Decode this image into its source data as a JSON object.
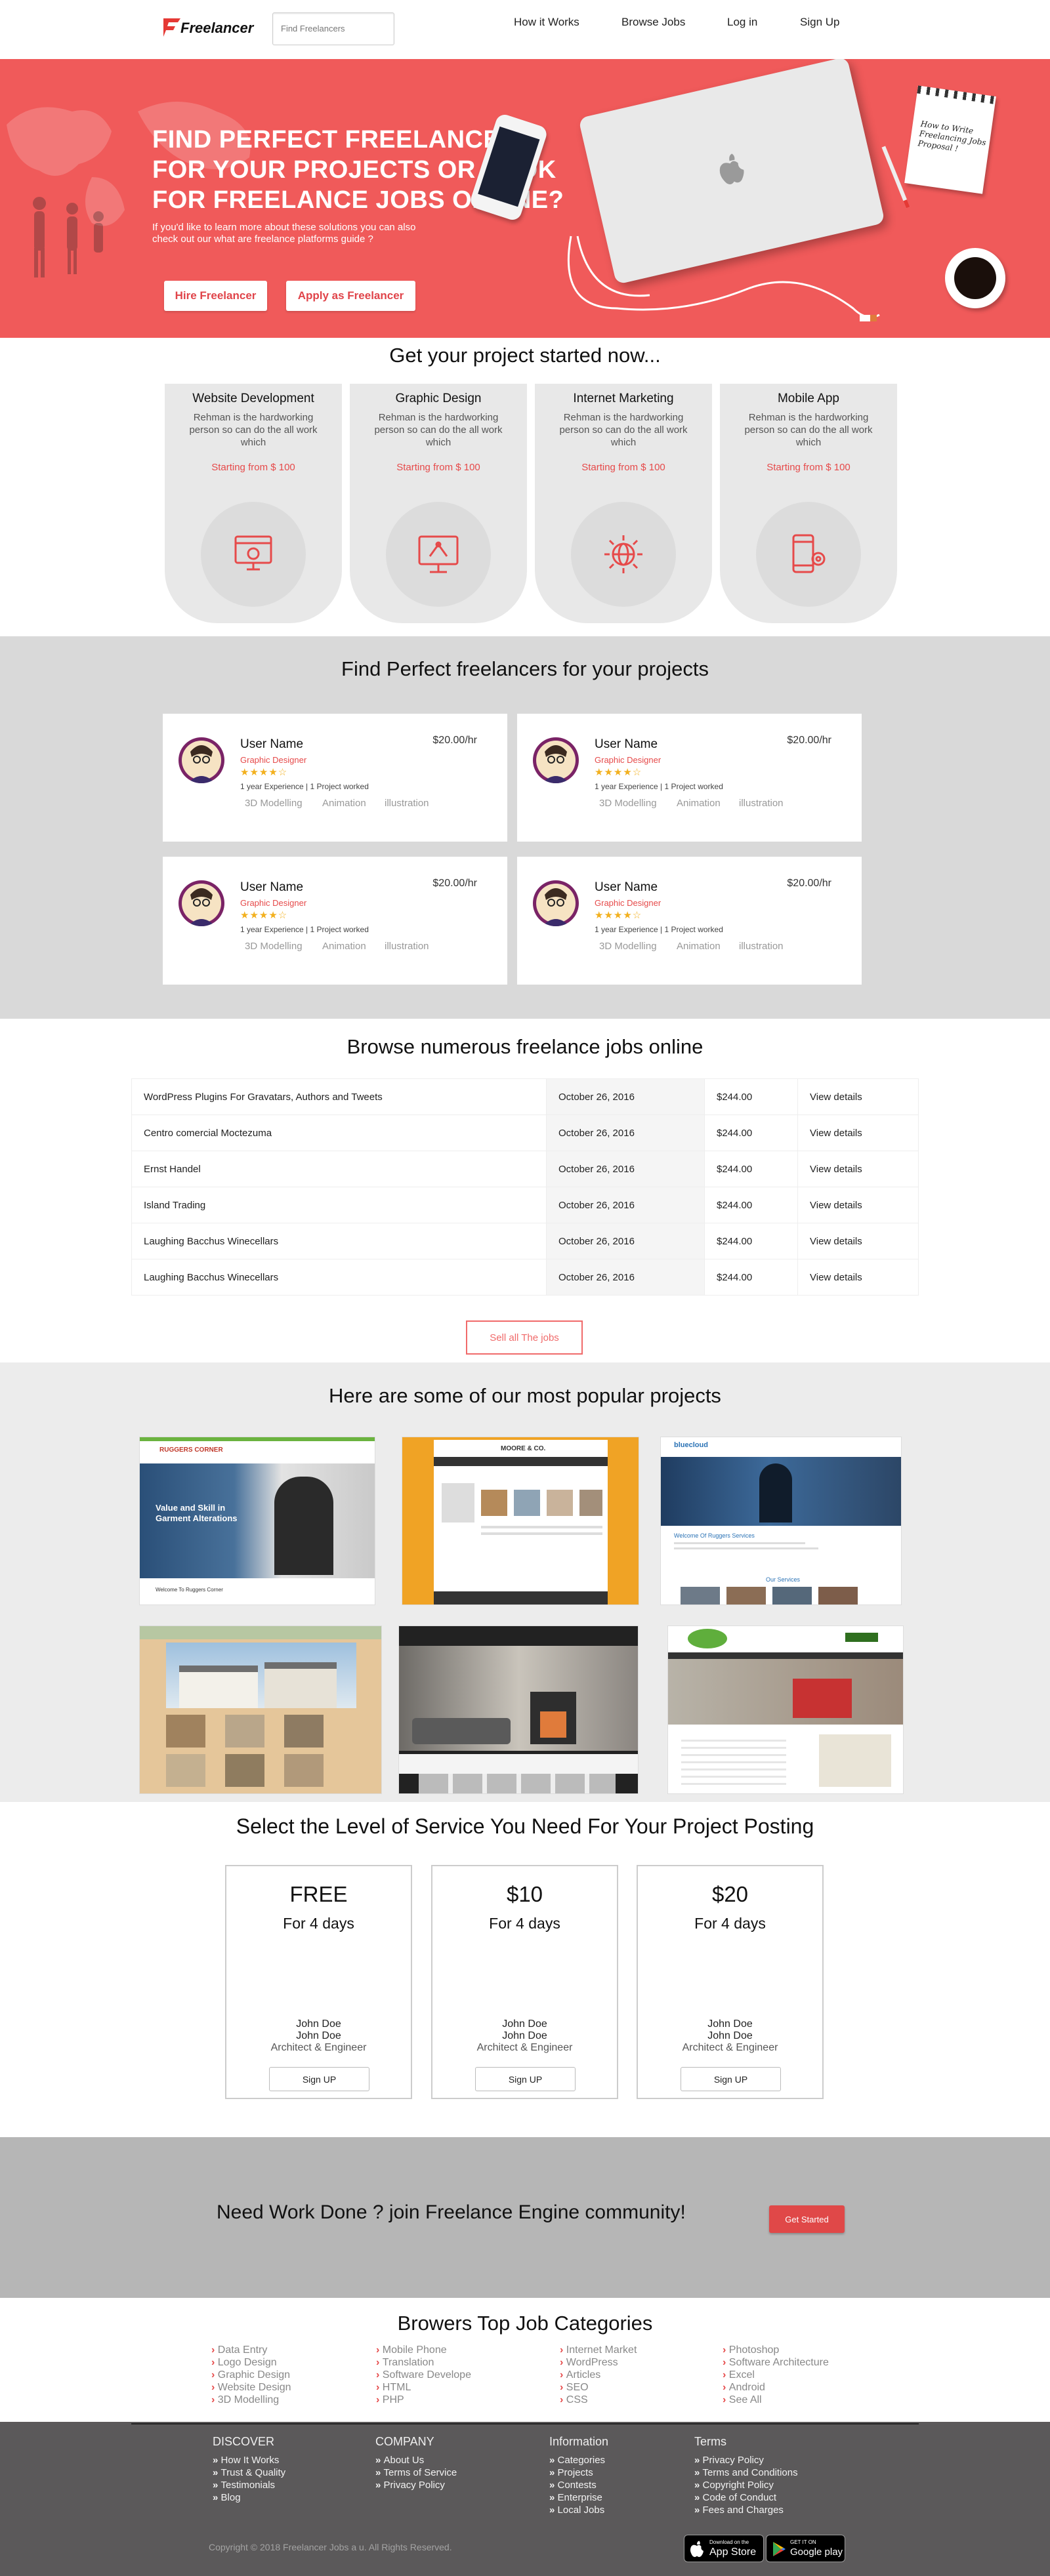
{
  "header": {
    "logo_text": "Freelancer",
    "search_placeholder": "Find Freelancers",
    "nav": [
      "How it Works",
      "Browse Jobs",
      "Log in",
      "Sign Up"
    ]
  },
  "hero": {
    "title_lines": [
      "FIND PERFECT FREELANCERS",
      "FOR YOUR PROJECTS OR LOOK",
      "FOR FREELANCE JOBS ONLINE?"
    ],
    "subtitle_lines": [
      "If you'd like to learn more about these solutions you can also",
      "check out our what are freelance platforms guide ?"
    ],
    "btn_hire": "Hire Freelancer",
    "btn_apply": "Apply as Freelancer",
    "note_lines": [
      "How to Write",
      "Freelancing Jobs",
      "Proposal !"
    ]
  },
  "services": {
    "title": "Get your project started now...",
    "items": [
      {
        "title": "Website Development",
        "desc": "Rehman is the hardworking person so can do the all work which",
        "price": "Starting from $ 100",
        "icon": "website-dev-icon"
      },
      {
        "title": "Graphic Design",
        "desc": "Rehman is the hardworking person so can do the all work which",
        "price": "Starting from $ 100",
        "icon": "graphic-design-icon"
      },
      {
        "title": "Internet Marketing",
        "desc": "Rehman is the hardworking person so can do the all work which",
        "price": "Starting from $ 100",
        "icon": "internet-marketing-icon"
      },
      {
        "title": "Mobile App",
        "desc": "Rehman is the hardworking person so can do the all work which",
        "price": "Starting from $ 100",
        "icon": "mobile-app-icon"
      }
    ]
  },
  "freelancers": {
    "title": "Find Perfect freelancers for your projects",
    "cards": [
      {
        "name": "User Name",
        "rate": "$20.00/hr",
        "role": "Graphic Designer",
        "stars": "★★★★☆",
        "rating": 4,
        "exp": "1 year Experience | 1 Project worked",
        "tags": [
          "3D Modelling",
          "Animation",
          "illustration"
        ]
      },
      {
        "name": "User Name",
        "rate": "$20.00/hr",
        "role": "Graphic Designer",
        "stars": "★★★★☆",
        "rating": 4,
        "exp": "1 year Experience | 1 Project worked",
        "tags": [
          "3D Modelling",
          "Animation",
          "illustration"
        ]
      },
      {
        "name": "User Name",
        "rate": "$20.00/hr",
        "role": "Graphic Designer",
        "stars": "★★★★☆",
        "rating": 4,
        "exp": "1 year Experience | 1 Project worked",
        "tags": [
          "3D Modelling",
          "Animation",
          "illustration"
        ]
      },
      {
        "name": "User Name",
        "rate": "$20.00/hr",
        "role": "Graphic Designer",
        "stars": "★★★★☆",
        "rating": 4,
        "exp": "1 year Experience | 1 Project worked",
        "tags": [
          "3D Modelling",
          "Animation",
          "illustration"
        ]
      }
    ]
  },
  "jobs": {
    "title": "Browse numerous freelance jobs online",
    "rows": [
      {
        "name": "WordPress Plugins For Gravatars, Authors and Tweets",
        "date": "October 26, 2016",
        "price": "$244.00",
        "link": "View details"
      },
      {
        "name": "Centro comercial Moctezuma",
        "date": "October 26, 2016",
        "price": "$244.00",
        "link": "View details"
      },
      {
        "name": "Ernst Handel",
        "date": "October 26, 2016",
        "price": "$244.00",
        "link": "View details"
      },
      {
        "name": "Island Trading",
        "date": "October 26, 2016",
        "price": "$244.00",
        "link": "View details"
      },
      {
        "name": "Laughing Bacchus Winecellars",
        "date": "October 26, 2016",
        "price": "$244.00",
        "link": "View details"
      },
      {
        "name": "Laughing Bacchus Winecellars",
        "date": "October 26, 2016",
        "price": "$244.00",
        "link": "View details"
      }
    ],
    "see_all": "Sell all The jobs"
  },
  "projects": {
    "title": "Here are some of our most popular projects",
    "p1_brand": "RUGGERS CORNER",
    "p1_headline": "Value and Skill in Garment Alterations",
    "p1_footer": "Welcome To Ruggers Corner",
    "p2_brand": "MOORE & CO.",
    "p3_brand": "bluecloud",
    "p3_heading": "Welcome Of Ruggers Services",
    "p3_services": "Our Services"
  },
  "plans": {
    "title": "Select the Level of Service You Need For Your Project Posting",
    "items": [
      {
        "price": "FREE",
        "duration": "For 4 days",
        "n1": "John Doe",
        "n2": "John Doe",
        "role": "Architect & Engineer",
        "btn": "Sign UP"
      },
      {
        "price": "$10",
        "duration": "For 4 days",
        "n1": "John Doe",
        "n2": "John Doe",
        "role": "Architect & Engineer",
        "btn": "Sign UP"
      },
      {
        "price": "$20",
        "duration": "For 4 days",
        "n1": "John Doe",
        "n2": "John Doe",
        "role": "Architect & Engineer",
        "btn": "Sign UP"
      }
    ]
  },
  "cta": {
    "text": "Need Work Done ? join Freelance Engine community!",
    "btn": "Get Started"
  },
  "categories": {
    "title": "Browers Top Job Categories",
    "cols": [
      [
        "Data Entry",
        "Logo Design",
        "Graphic Design",
        "Website Design",
        "3D Modelling"
      ],
      [
        "Mobile Phone",
        "Translation",
        "Software Develope",
        "HTML",
        "PHP"
      ],
      [
        "Internet Market",
        "WordPress",
        "Articles",
        "SEO",
        "CSS"
      ],
      [
        "Photoshop",
        "Software Architecture",
        "Excel",
        "Android",
        "See All"
      ]
    ]
  },
  "footer": {
    "cols": [
      {
        "title": "DISCOVER",
        "items": [
          "How It Works",
          "Trust & Quality",
          "Testimonials",
          "Blog"
        ]
      },
      {
        "title": "COMPANY",
        "items": [
          "About Us",
          "Terms of Service",
          "Privacy Policy"
        ]
      },
      {
        "title": "Information",
        "items": [
          "Categories",
          "Projects",
          "Contests",
          "Enterprise",
          "Local Jobs"
        ]
      },
      {
        "title": "Terms",
        "items": [
          "Privacy Policy",
          "Terms and Conditions",
          "Copyright Policy",
          "Code of Conduct",
          "Fees and Charges"
        ]
      }
    ],
    "copyright": "Copyright © 2018 Freelancer Jobs a u. All Rights Reserved.",
    "appstore_small": "Download on the",
    "appstore": "App Store",
    "gplay_small": "GET IT ON",
    "gplay": "Google play"
  },
  "colors": {
    "accent": "#f05a5a",
    "grey_section": "#d9d9d9",
    "footer": "#5b595a"
  }
}
